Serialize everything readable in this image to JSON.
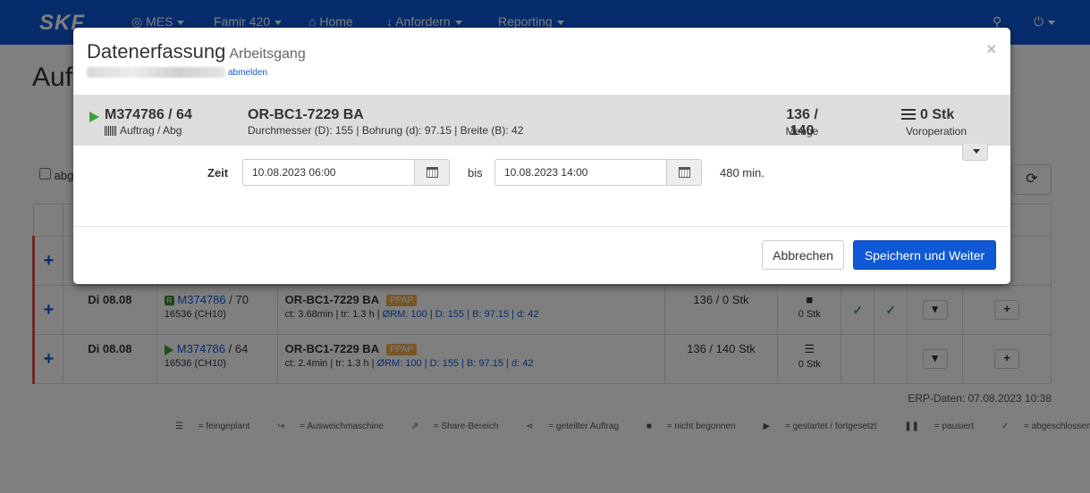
{
  "navbar": {
    "logo": "SKF",
    "items": [
      {
        "label": "MES",
        "icon": "target-icon"
      },
      {
        "label": "Famir 420"
      },
      {
        "label": "Home",
        "icon": "home-icon"
      },
      {
        "label": "Anfordern",
        "icon": "arrow-down-icon"
      },
      {
        "label": "Reporting"
      }
    ],
    "search_icon": "search-icon",
    "power_icon": "power-icon"
  },
  "page": {
    "title": "Auf",
    "checkbox_label": "abg"
  },
  "table": {
    "rows": [
      {
        "day": "Di 08.08",
        "order": "M374786",
        "step": "/ 70",
        "sub": "16536 (CH10)",
        "article": "OR-BC1-7229 BA",
        "badge": "PPAP",
        "ct": "ct: 3.68min | tr: 1.3 h |",
        "details": "ØRM: 100 | D: 155 | B: 97.15 | d: 42",
        "qty": "136 / 0 Stk",
        "status_count": "0 Stk"
      },
      {
        "day": "Di 08.08",
        "order": "M374786",
        "step": "/ 64",
        "sub": "16536 (CH10)",
        "article": "OR-BC1-7229 BA",
        "badge": "PPAP",
        "ct": "ct: 2.4min | tr: 1.3 h |",
        "details": "ØRM: 100 | D: 155 | B: 97.15 | d: 42",
        "qty": "136 / 140 Stk",
        "status_count": "0 Stk"
      }
    ]
  },
  "erp": "ERP-Daten: 07.08.2023 10:38",
  "legend": [
    "= feingeplant",
    "= Ausweichmaschine",
    "= Share-Bereich",
    "= geteilter Auftrag",
    "= nicht begonnen",
    "= gestartet / fortgesetzt",
    "= pausiert",
    "= abgeschlossen"
  ],
  "modal": {
    "title": "Datenerfassung",
    "subtitle": "Arbeitsgang",
    "logout": "abmelden",
    "close": "×",
    "order": "M374786 / 64",
    "order_label": "Auftrag / Abg",
    "article": "OR-BC1-7229 BA",
    "dimensions": "Durchmesser (D): 155 | Bohrung (d): 97.15 | Breite (B): 42",
    "quantity": "136 / 140",
    "quantity_label": "Menge",
    "previous": "0 Stk",
    "previous_label": "Voroperation",
    "zeit_label": "Zeit",
    "start": "10.08.2023 06:00",
    "bis": "bis",
    "end": "10.08.2023 14:00",
    "duration": "480 min.",
    "cancel": "Abbrechen",
    "save": "Speichern und Weiter"
  }
}
